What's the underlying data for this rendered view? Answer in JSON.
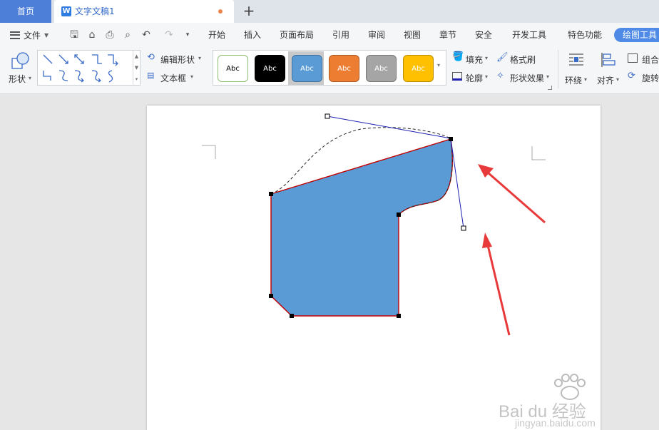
{
  "tabs": {
    "home_label": "首页",
    "doc_label": "文字文稿1",
    "doc_icon": "W"
  },
  "menu": {
    "file_label": "文件",
    "items": [
      "开始",
      "插入",
      "页面布局",
      "引用",
      "审阅",
      "视图",
      "章节",
      "安全",
      "开发工具",
      "特色功能"
    ],
    "active": "绘图工具"
  },
  "ribbon": {
    "shapes_label": "形状",
    "edit_shape_label": "编辑形状",
    "textbox_label": "文本框",
    "styles": [
      {
        "label": "Abc",
        "bg": "#ffffff",
        "border": "#8cbf73",
        "text": "#000000"
      },
      {
        "label": "Abc",
        "bg": "#000000",
        "border": "#000000",
        "text": "#ffffff"
      },
      {
        "label": "Abc",
        "bg": "#5b9bd5",
        "border": "#41719c",
        "text": "#ffffff"
      },
      {
        "label": "Abc",
        "bg": "#ed7d31",
        "border": "#ae5a21",
        "text": "#ffffff"
      },
      {
        "label": "Abc",
        "bg": "#a5a5a5",
        "border": "#787878",
        "text": "#ffffff"
      },
      {
        "label": "Abc",
        "bg": "#ffc000",
        "border": "#bc8c00",
        "text": "#ffffff"
      }
    ],
    "fill_label": "填充",
    "outline_label": "轮廓",
    "format_painter_label": "格式刷",
    "shape_effects_label": "形状效果",
    "wrap_label": "环绕",
    "align_label": "对齐",
    "group_label": "组合",
    "rotate_label": "旋转"
  },
  "document": {
    "shape_fill": "#5b9bd5",
    "shape_stroke": "#c00000",
    "control_line": "#1f1fb4",
    "annotation_arrow": "#e83a3a"
  },
  "watermark": {
    "brand": "Bai du 经验",
    "url": "jingyan.baidu.com"
  }
}
